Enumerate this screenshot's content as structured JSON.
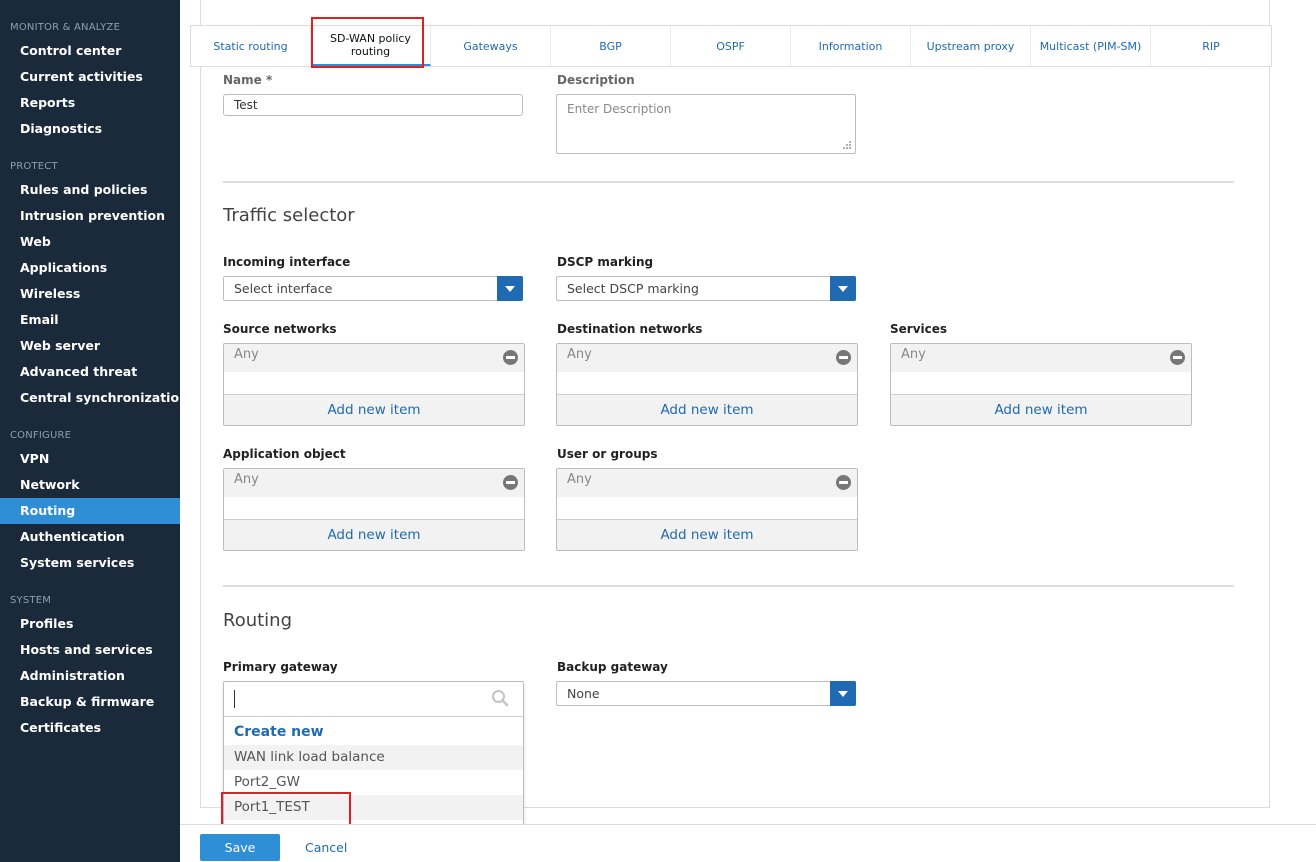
{
  "sidebar": {
    "sections": [
      {
        "title": "MONITOR & ANALYZE",
        "items": [
          "Control center",
          "Current activities",
          "Reports",
          "Diagnostics"
        ]
      },
      {
        "title": "PROTECT",
        "items": [
          "Rules and policies",
          "Intrusion prevention",
          "Web",
          "Applications",
          "Wireless",
          "Email",
          "Web server",
          "Advanced threat",
          "Central synchronization"
        ]
      },
      {
        "title": "CONFIGURE",
        "items": [
          "VPN",
          "Network",
          "Routing",
          "Authentication",
          "System services"
        ]
      },
      {
        "title": "SYSTEM",
        "items": [
          "Profiles",
          "Hosts and services",
          "Administration",
          "Backup & firmware",
          "Certificates"
        ]
      }
    ],
    "active_item": "Routing"
  },
  "tabs": [
    {
      "label": "Static routing"
    },
    {
      "label": "SD-WAN policy routing",
      "active": true
    },
    {
      "label": "Gateways"
    },
    {
      "label": "BGP"
    },
    {
      "label": "OSPF"
    },
    {
      "label": "Information"
    },
    {
      "label": "Upstream proxy"
    },
    {
      "label": "Multicast (PIM-SM)"
    },
    {
      "label": "RIP"
    }
  ],
  "form": {
    "name_label": "Name *",
    "name_value": "Test",
    "description_label": "Description",
    "description_placeholder": "Enter Description"
  },
  "traffic_selector": {
    "title": "Traffic selector",
    "incoming_interface_label": "Incoming interface",
    "incoming_interface_value": "Select interface",
    "dscp_label": "DSCP marking",
    "dscp_value": "Select DSCP marking",
    "source_networks": {
      "label": "Source networks",
      "value": "Any",
      "add": "Add new item"
    },
    "destination_networks": {
      "label": "Destination networks",
      "value": "Any",
      "add": "Add new item"
    },
    "services": {
      "label": "Services",
      "value": "Any",
      "add": "Add new item"
    },
    "application_object": {
      "label": "Application object",
      "value": "Any",
      "add": "Add new item"
    },
    "user_or_groups": {
      "label": "User or groups",
      "value": "Any",
      "add": "Add new item"
    }
  },
  "routing": {
    "title": "Routing",
    "primary_gateway_label": "Primary gateway",
    "backup_gateway_label": "Backup gateway",
    "backup_gateway_value": "None",
    "dropdown": {
      "create_new": "Create new",
      "options": [
        "WAN link load balance",
        "Port2_GW",
        "Port1_TEST"
      ]
    }
  },
  "footer": {
    "save": "Save",
    "cancel": "Cancel"
  },
  "colors": {
    "sidebar_bg": "#1a2a3a",
    "accent": "#2f8fd6",
    "link": "#1f6ab0",
    "highlight": "#e02020"
  }
}
